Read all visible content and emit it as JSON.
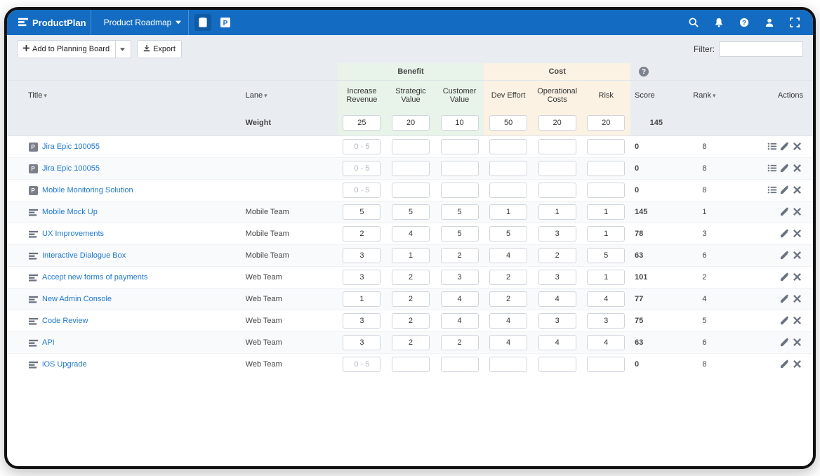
{
  "brand": "ProductPlan",
  "roadmap_name": "Product Roadmap",
  "toolbar": {
    "add_label": "Add to Planning Board",
    "export_label": "Export",
    "filter_label": "Filter:"
  },
  "groups": {
    "benefit": "Benefit",
    "cost": "Cost"
  },
  "columns": {
    "title": "Title",
    "lane": "Lane",
    "increase_revenue": "Increase Revenue",
    "strategic_value": "Strategic Value",
    "customer_value": "Customer Value",
    "dev_effort": "Dev Effort",
    "operational_costs": "Operational Costs",
    "risk": "Risk",
    "score": "Score",
    "rank": "Rank",
    "actions": "Actions"
  },
  "weight_label": "Weight",
  "weights": {
    "increase_revenue": "25",
    "strategic_value": "20",
    "customer_value": "10",
    "dev_effort": "50",
    "operational_costs": "20",
    "risk": "20",
    "total": "145"
  },
  "value_placeholder": "0 - 5",
  "rows": [
    {
      "icon": "p",
      "title": "Jira Epic 100055",
      "lane": "",
      "vals": [
        "",
        "",
        "",
        "",
        "",
        ""
      ],
      "score": "0",
      "rank": "8",
      "actions": [
        "list",
        "edit",
        "delete"
      ]
    },
    {
      "icon": "p",
      "title": "Jira Epic 100055",
      "lane": "",
      "vals": [
        "",
        "",
        "",
        "",
        "",
        ""
      ],
      "score": "0",
      "rank": "8",
      "actions": [
        "list",
        "edit",
        "delete"
      ]
    },
    {
      "icon": "p",
      "title": "Mobile Monitoring Solution",
      "lane": "",
      "vals": [
        "",
        "",
        "",
        "",
        "",
        ""
      ],
      "score": "0",
      "rank": "8",
      "actions": [
        "list",
        "edit",
        "delete"
      ]
    },
    {
      "icon": "bar",
      "title": "Mobile Mock Up",
      "lane": "Mobile Team",
      "vals": [
        "5",
        "5",
        "5",
        "1",
        "1",
        "1"
      ],
      "score": "145",
      "rank": "1",
      "actions": [
        "edit",
        "delete"
      ]
    },
    {
      "icon": "bar",
      "title": "UX Improvements",
      "lane": "Mobile Team",
      "vals": [
        "2",
        "4",
        "5",
        "5",
        "3",
        "1"
      ],
      "score": "78",
      "rank": "3",
      "actions": [
        "edit",
        "delete"
      ]
    },
    {
      "icon": "bar",
      "title": "Interactive Dialogue Box",
      "lane": "Mobile Team",
      "vals": [
        "3",
        "1",
        "2",
        "4",
        "2",
        "5"
      ],
      "score": "63",
      "rank": "6",
      "actions": [
        "edit",
        "delete"
      ]
    },
    {
      "icon": "bar",
      "title": "Accept new forms of payments",
      "lane": "Web Team",
      "vals": [
        "3",
        "2",
        "3",
        "2",
        "3",
        "1"
      ],
      "score": "101",
      "rank": "2",
      "actions": [
        "edit",
        "delete"
      ]
    },
    {
      "icon": "bar",
      "title": "New Admin Console",
      "lane": "Web Team",
      "vals": [
        "1",
        "2",
        "4",
        "2",
        "4",
        "4"
      ],
      "score": "77",
      "rank": "4",
      "actions": [
        "edit",
        "delete"
      ]
    },
    {
      "icon": "bar",
      "title": "Code Review",
      "lane": "Web Team",
      "vals": [
        "3",
        "2",
        "4",
        "4",
        "3",
        "3"
      ],
      "score": "75",
      "rank": "5",
      "actions": [
        "edit",
        "delete"
      ]
    },
    {
      "icon": "bar",
      "title": "API",
      "lane": "Web Team",
      "vals": [
        "3",
        "2",
        "2",
        "4",
        "4",
        "4"
      ],
      "score": "63",
      "rank": "6",
      "actions": [
        "edit",
        "delete"
      ]
    },
    {
      "icon": "bar",
      "title": "iOS Upgrade",
      "lane": "Web Team",
      "vals": [
        "",
        "",
        "",
        "",
        "",
        ""
      ],
      "score": "0",
      "rank": "8",
      "actions": [
        "edit",
        "delete"
      ]
    }
  ]
}
